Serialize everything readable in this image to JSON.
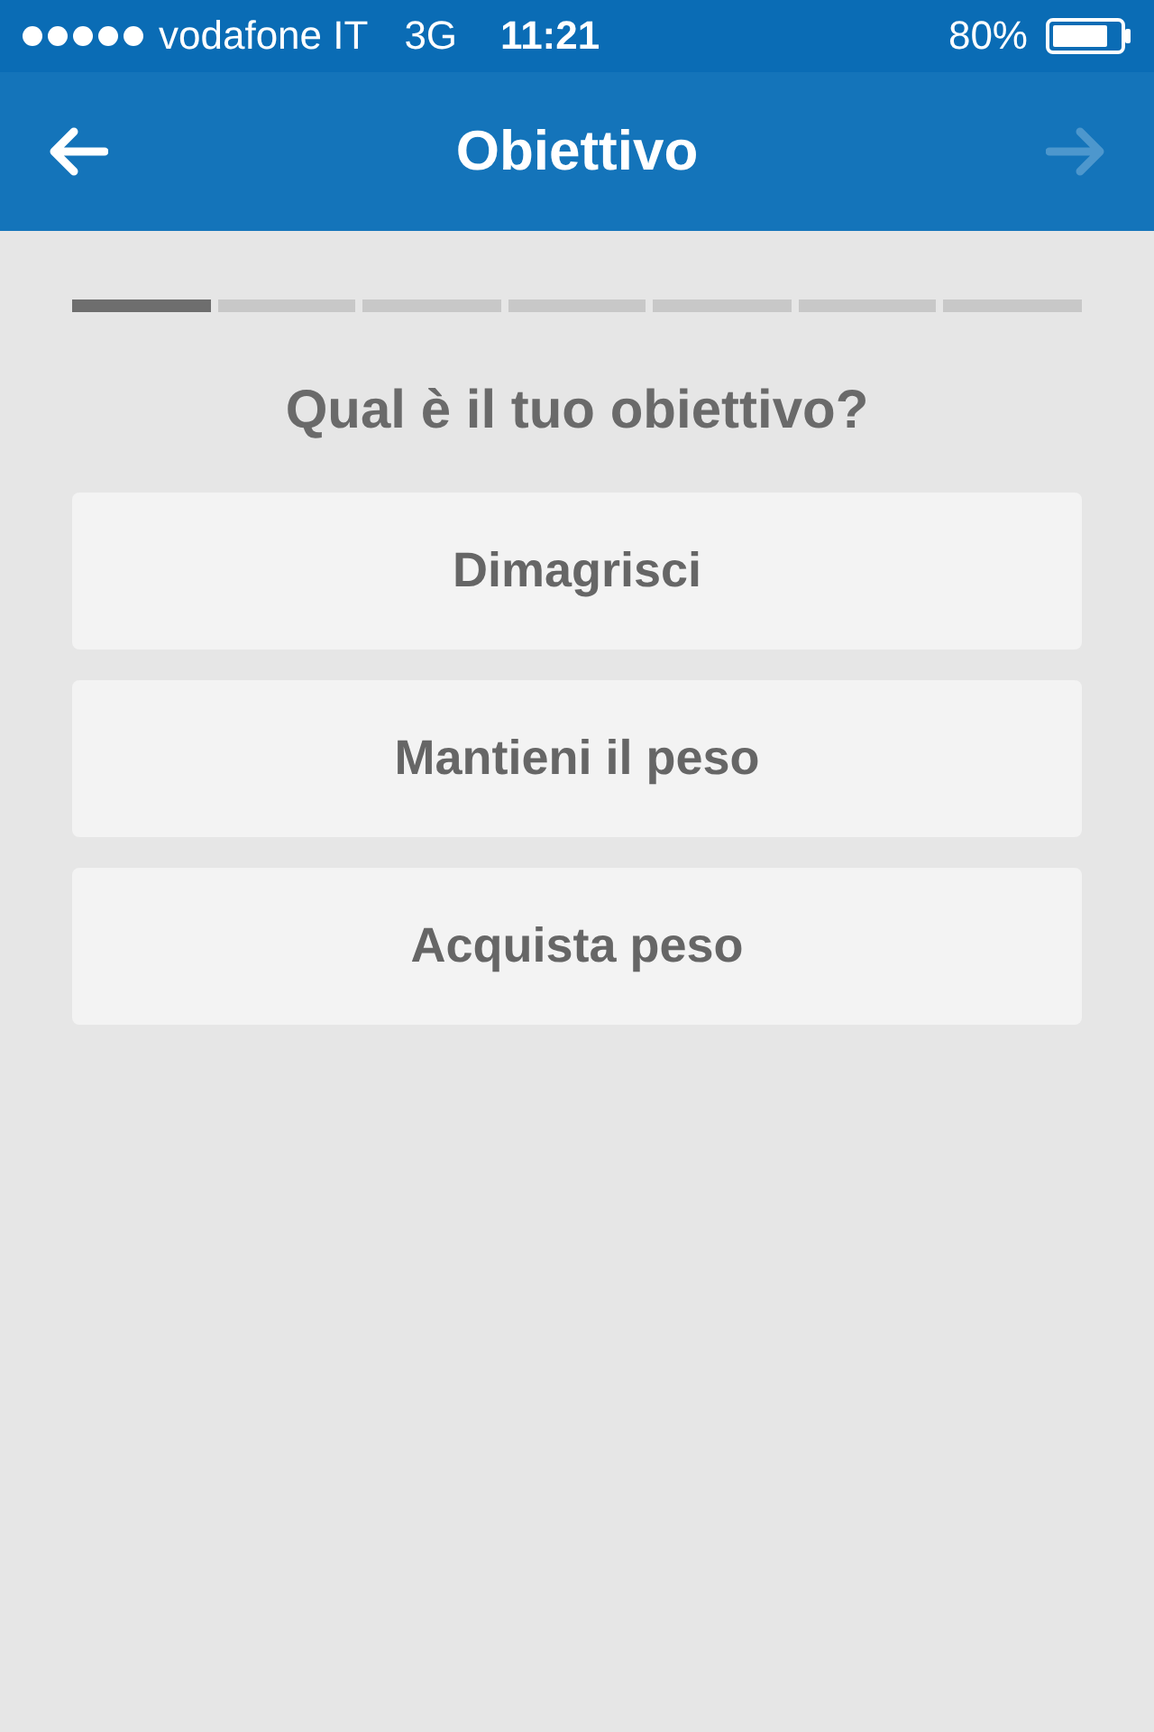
{
  "status_bar": {
    "carrier": "vodafone IT",
    "network": "3G",
    "time": "11:21",
    "battery": "80%"
  },
  "nav": {
    "title": "Obiettivo",
    "back": {
      "disabled": false
    },
    "forward": {
      "disabled": true
    }
  },
  "progress": [
    {
      "completed": true
    },
    {
      "completed": false
    },
    {
      "completed": false
    },
    {
      "completed": false
    },
    {
      "completed": false
    },
    {
      "completed": false
    },
    {
      "completed": false
    }
  ],
  "question": "Qual è il tuo obiettivo?",
  "options": [
    "Dimagrisci",
    "Mantieni il peso",
    "Acquista peso"
  ]
}
